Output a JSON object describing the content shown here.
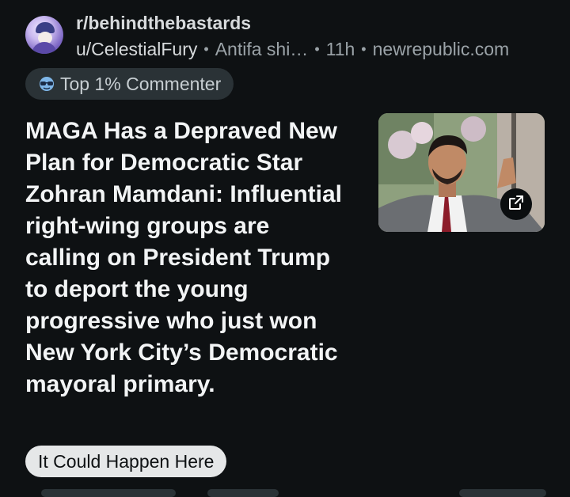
{
  "post": {
    "subreddit": "r/behindthebastards",
    "username": "u/CelestialFury",
    "user_flair": "Antifa shi…",
    "separator": "•",
    "age": "11h",
    "domain": "newrepublic.com",
    "badge_label": "Top 1% Commenter",
    "title": "MAGA Has a Depraved New Plan for Democratic Star Zohran Mamdani: Influential right-wing groups are calling on President Trump to deport the young progressive who just won New York City’s Democratic mayoral primary.",
    "post_flair": "It Could Happen Here"
  },
  "icons": {
    "avatar": "user-avatar",
    "badge": "sunglasses-icon",
    "external_link": "external-link-icon"
  },
  "colors": {
    "background": "#0e1113",
    "primary_text": "#f2f4f5",
    "secondary_text": "#9ba3a8",
    "badge_bg": "#2a3236",
    "flair_bg": "#e5e7e8"
  }
}
